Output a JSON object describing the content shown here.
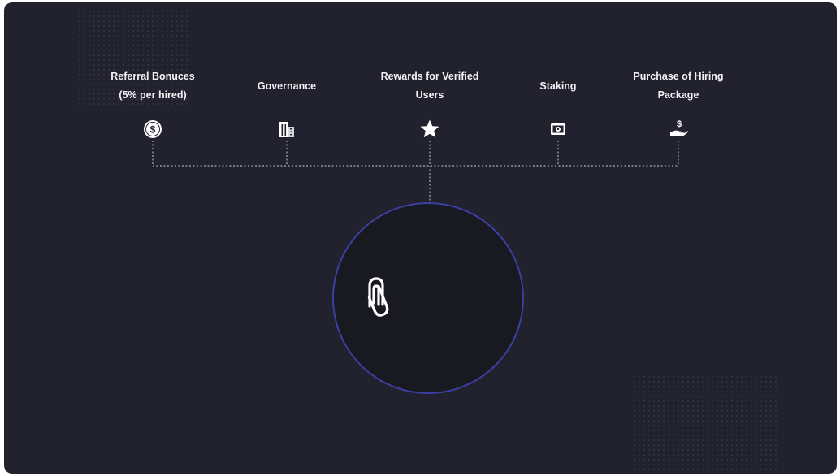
{
  "diagram": {
    "nodes": [
      {
        "id": "referral",
        "label_lines": [
          "Referral Bonuces",
          "(5% per hired)"
        ],
        "icon": "dollar-coin-icon"
      },
      {
        "id": "governance",
        "label_lines": [
          "Governance"
        ],
        "icon": "building-icon"
      },
      {
        "id": "rewards",
        "label_lines": [
          "Rewards for Verified",
          "Users"
        ],
        "icon": "star-icon"
      },
      {
        "id": "staking",
        "label_lines": [
          "Staking"
        ],
        "icon": "vault-icon"
      },
      {
        "id": "purchase",
        "label_lines": [
          "Purchase of Hiring",
          "Package"
        ],
        "icon": "hand-dollar-icon"
      }
    ],
    "hub": {
      "icon": "paperclip-logo-icon"
    },
    "colors": {
      "background": "#22222f",
      "text": "#f2f2f5",
      "connector": "#a9a9b8",
      "hub_border": "#3b3fa0",
      "hub_fill": "#191922"
    }
  }
}
